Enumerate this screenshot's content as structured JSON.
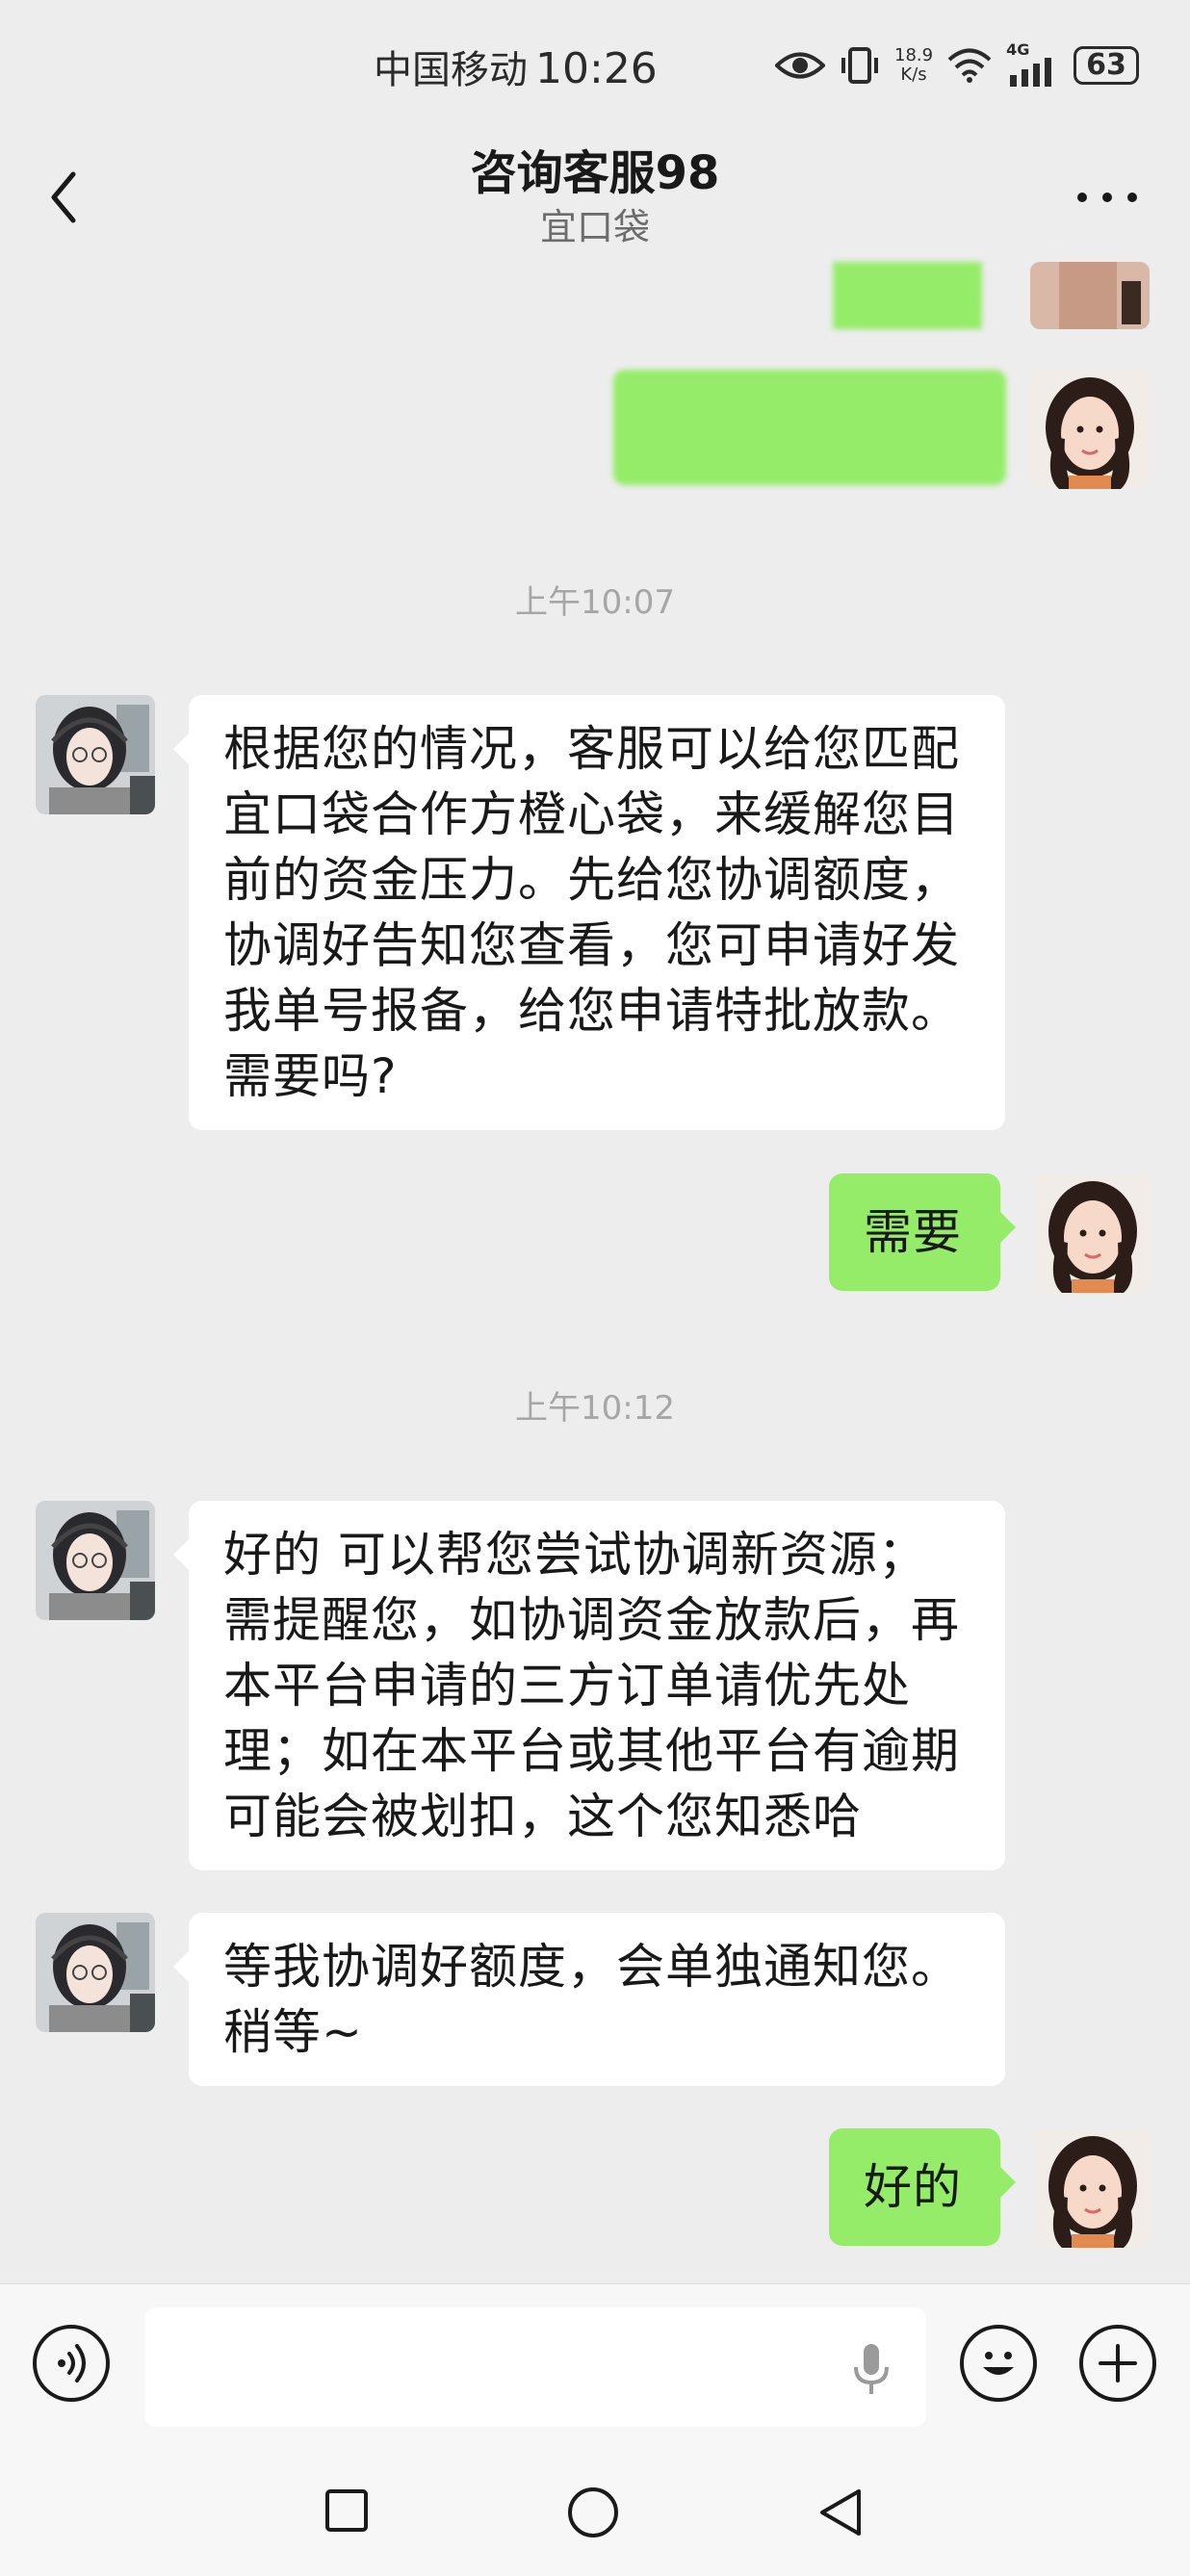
{
  "status_bar": {
    "carrier": "中国移动",
    "time": "10:26",
    "net_speed_value": "18.9",
    "net_speed_unit": "K/s",
    "network": "4G",
    "battery": "63"
  },
  "header": {
    "title": "咨询客服98",
    "subtitle": "宜口袋"
  },
  "messages": {
    "ts1": "上午10:07",
    "m1": "根据您的情况，客服可以给您匹配宜口袋合作方橙心袋，来缓解您目前的资金压力。先给您协调额度，协调好告知您查看，您可申请好发我单号报备，给您申请特批放款。需要吗?",
    "m2": "需要",
    "ts2": "上午10:12",
    "m3": "好的 可以帮您尝试协调新资源；需提醒您，如协调资金放款后，再本平台申请的三方订单请优先处理；如在本平台或其他平台有逾期可能会被划扣，这个您知悉哈",
    "m4": "等我协调好额度，会单独通知您。稍等~",
    "m5": "好的"
  },
  "colors": {
    "background": "#ededed",
    "bubble_self": "#95ec69",
    "bubble_other": "#ffffff"
  },
  "icons": [
    "back-arrow-icon",
    "more-icon",
    "voice-icon",
    "mic-icon",
    "emoji-icon",
    "plus-icon",
    "square-nav-icon",
    "circle-nav-icon",
    "triangle-nav-icon"
  ]
}
